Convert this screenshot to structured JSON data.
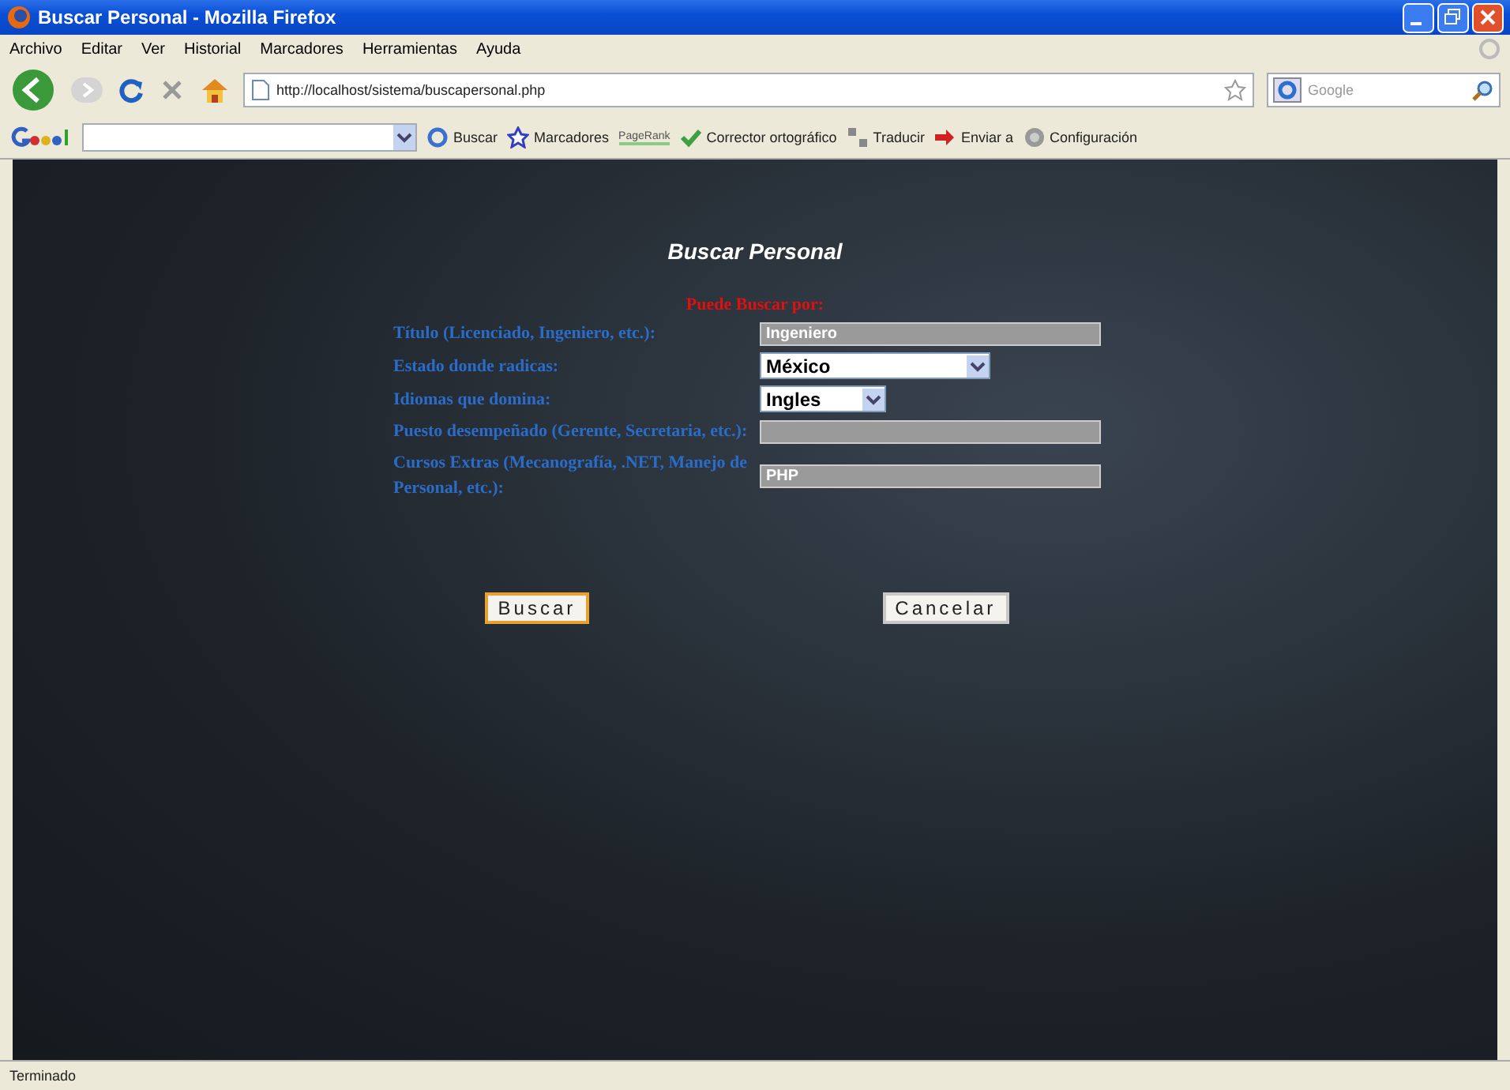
{
  "window": {
    "title": "Buscar Personal - Mozilla Firefox"
  },
  "menu": [
    "Archivo",
    "Editar",
    "Ver",
    "Historial",
    "Marcadores",
    "Herramientas",
    "Ayuda"
  ],
  "navigation": {
    "url": "http://localhost/sistema/buscapersonal.php",
    "search_placeholder": "Google"
  },
  "google_toolbar": {
    "items": [
      {
        "label": "Buscar",
        "kind": "search"
      },
      {
        "label": "Marcadores",
        "kind": "star"
      },
      {
        "label": "PageRank",
        "kind": "rank"
      },
      {
        "label": "Corrector ortográfico",
        "kind": "check"
      },
      {
        "label": "Traducir",
        "kind": "translate"
      },
      {
        "label": "Enviar a",
        "kind": "send"
      },
      {
        "label": "Configuración",
        "kind": "settings"
      }
    ]
  },
  "page": {
    "title": "Buscar Personal",
    "subtitle": "Puede Buscar por:",
    "fields": [
      {
        "label": "Título (Licenciado, Ingeniero, etc.):",
        "kind": "text",
        "value": "Ingeniero"
      },
      {
        "label": "Estado donde radicas:",
        "kind": "select",
        "value": "México"
      },
      {
        "label": "Idiomas que domina:",
        "kind": "select",
        "value": "Ingles"
      },
      {
        "label": "Puesto desempeñado (Gerente, Secretaria, etc.):",
        "kind": "text"
      },
      {
        "label": "Cursos Extras (Mecanografía, .NET, Manejo de Personal, etc.):",
        "kind": "text",
        "value": "PHP"
      }
    ],
    "buttons": [
      {
        "label": "Buscar",
        "focused": true
      },
      {
        "label": "Cancelar",
        "focused": false
      }
    ]
  },
  "status_bar": "Terminado"
}
